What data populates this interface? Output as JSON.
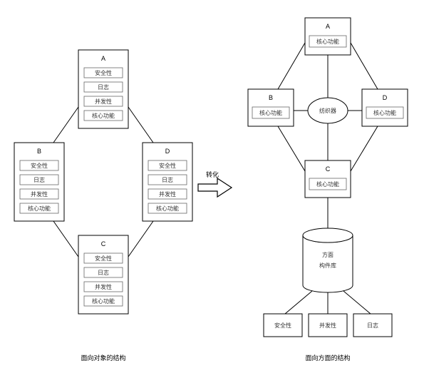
{
  "left": {
    "caption": "面向对象的结构",
    "boxes": {
      "A": {
        "title": "A",
        "items": [
          "安全性",
          "日志",
          "并发性",
          "核心功能"
        ]
      },
      "B": {
        "title": "B",
        "items": [
          "安全性",
          "日志",
          "并发性",
          "核心功能"
        ]
      },
      "C": {
        "title": "C",
        "items": [
          "安全性",
          "日志",
          "并发性",
          "核心功能"
        ]
      },
      "D": {
        "title": "D",
        "items": [
          "安全性",
          "日志",
          "并发性",
          "核心功能"
        ]
      }
    }
  },
  "arrow_label": "转化",
  "right": {
    "caption": "面向方面的结构",
    "boxes": {
      "A": {
        "title": "A",
        "item": "核心功能"
      },
      "B": {
        "title": "B",
        "item": "核心功能"
      },
      "C": {
        "title": "C",
        "item": "核心功能"
      },
      "D": {
        "title": "D",
        "item": "核心功能"
      }
    },
    "weaver": "纺织器",
    "library": {
      "line1": "方面",
      "line2": "构件库"
    },
    "aspects": [
      "安全性",
      "并发性",
      "日志"
    ]
  }
}
